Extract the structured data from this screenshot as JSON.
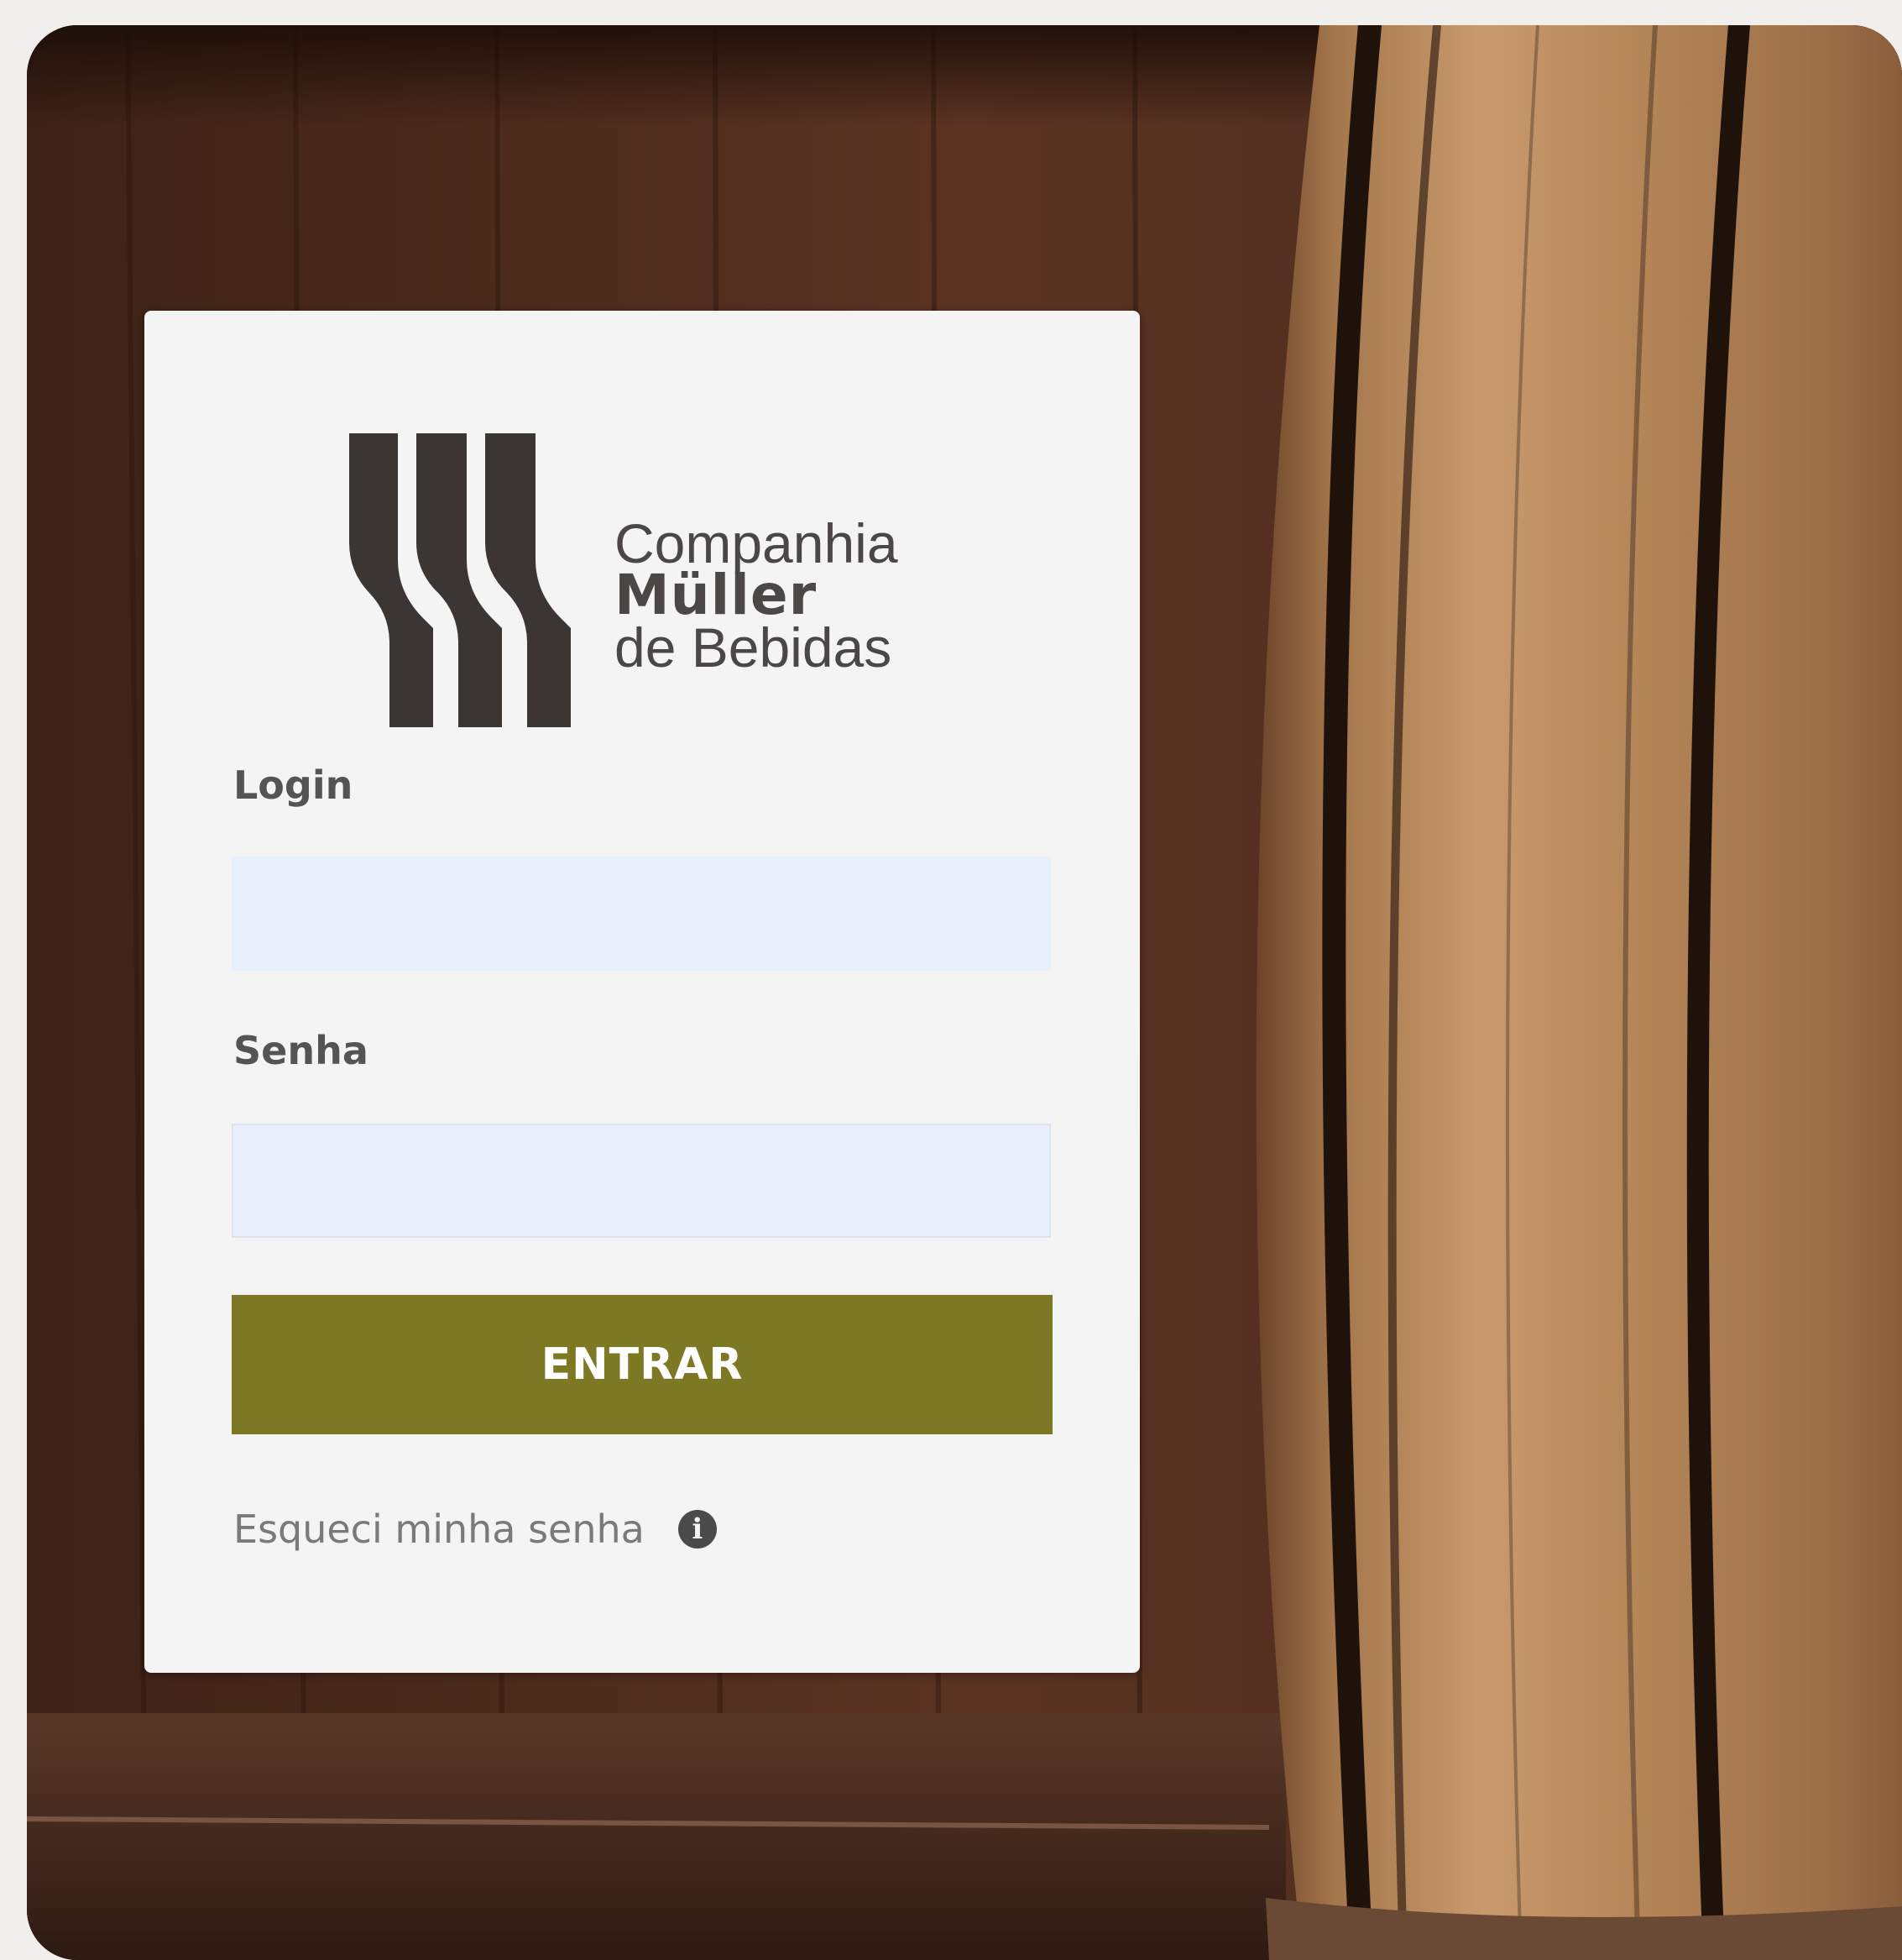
{
  "brand": {
    "line1": "Companhia",
    "line2": "Müller",
    "line3": "de Bebidas"
  },
  "form": {
    "login_label": "Login",
    "login_value": "",
    "password_label": "Senha",
    "password_value": "",
    "submit_label": "ENTRAR",
    "forgot_label": "Esqueci minha senha"
  },
  "icons": {
    "info": "info-circle-icon",
    "logo": "three-bottles-logo"
  },
  "colors": {
    "button": "#7d7823",
    "card": "#f4f4f4",
    "input_bg": "#e8f0fe",
    "wood_dark": "#4a2a1c",
    "barrel": "#b98a5e"
  }
}
